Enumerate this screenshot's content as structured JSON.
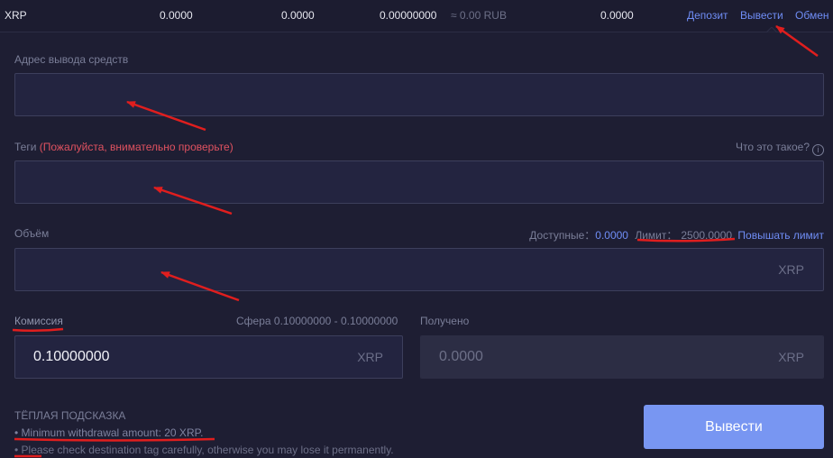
{
  "topbar": {
    "coin": "XRP",
    "balance_1": "0.0000",
    "balance_2": "0.0000",
    "balance_3": "0.00000000",
    "approx_rub": "≈ 0.00 RUB",
    "balance_4": "0.0000",
    "deposit_label": "Депозит",
    "withdraw_label": "Вывести",
    "exchange_label": "Обмен"
  },
  "address": {
    "label": "Адрес вывода средств",
    "value": ""
  },
  "tags": {
    "label": "Теги",
    "warning": "(Пожалуйста, внимательно проверьте)",
    "help": "Что это такое?",
    "value": ""
  },
  "volume": {
    "label": "Объём",
    "available_label": "Доступные：",
    "available_value": "0.0000",
    "limit_label": "Лимит：",
    "limit_value": "2500.0000",
    "raise_limit": "Повышать лимит",
    "unit": "XRP",
    "value": ""
  },
  "fee": {
    "label": "Комиссия",
    "range": "Сфера 0.10000000 - 0.10000000",
    "value": "0.10000000",
    "unit": "XRP"
  },
  "received": {
    "label": "Получено",
    "value": "0.0000",
    "unit": "XRP"
  },
  "hint": {
    "title": "ТЁПЛАЯ ПОДСКАЗКА",
    "line_1": "• Minimum withdrawal amount: 20 XRP.",
    "line_2": "• Please check destination tag carefully, otherwise you may lose it permanently."
  },
  "submit_label": "Вывести",
  "colors": {
    "accent": "#7896f2",
    "annotation": "#e01e1e",
    "background": "#1e1e33"
  }
}
